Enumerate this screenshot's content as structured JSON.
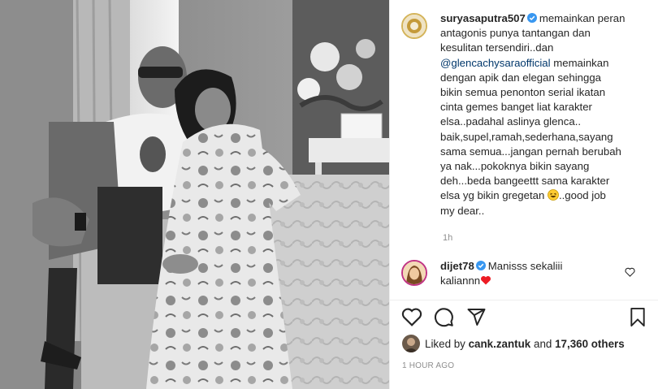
{
  "post": {
    "username": "suryasaputra507",
    "caption_lines": [
      "memainkan peran",
      "antagonis punya tantangan dan",
      "kesulitan tersendiri..dan",
      "@glencachysaraofficial",
      "memainkan",
      "dengan apik dan elegan sehingga",
      "bikin semua penonton serial ikatan",
      "cinta gemes banget liat karakter",
      "elsa..padahal aslinya glenca..",
      "baik,supel,ramah,sederhana,sayang",
      "sama semua...jangan pernah berubah",
      "ya nak...pokoknya bikin sayang",
      "deh...beda bangeettt sama karakter",
      "elsa yg bikin gregetan",
      "..good job",
      "my dear.."
    ],
    "caption_time": "1h"
  },
  "comment": {
    "username": "dijet78",
    "text_line1": "Manisss sekaliii",
    "text_line2": "kaliannn"
  },
  "likes": {
    "prefix": "Liked by",
    "user": "cank.zantuk",
    "middle": "and",
    "count": "17,360 others"
  },
  "timestamp": "1 HOUR AGO",
  "icons": {
    "like": "heart-outline-icon",
    "comment": "comment-bubble-icon",
    "share": "paper-plane-icon",
    "save": "bookmark-icon",
    "verified": "verified-badge-icon"
  },
  "colors": {
    "verified": "#3897f0",
    "mention": "#00376b",
    "secondary_text": "#8e8e8e",
    "heart_emoji": "#ed1c24"
  }
}
